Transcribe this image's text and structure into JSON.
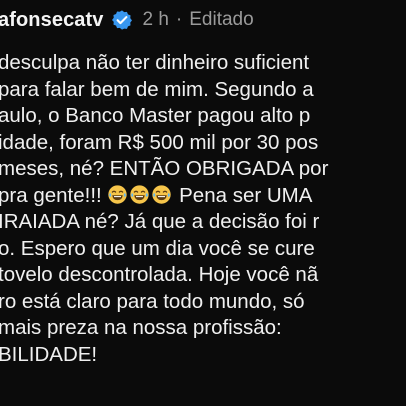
{
  "post": {
    "username": "afonsecatv",
    "time": "2 h",
    "separator": "·",
    "edited_label": "Editado",
    "verified_icon": "verified-badge-icon",
    "colors": {
      "background": "#0b0b0b",
      "text": "#f0f0f0",
      "meta": "#9a9a9a",
      "verified": "#3897f0"
    }
  },
  "comment": {
    "lines": [
      "desculpa não ter dinheiro suficient",
      "para falar bem de mim. Segundo a",
      "aulo, o Banco Master pagou alto p",
      "idade, foram R$ 500 mil por 30 pos",
      "meses, né? ENTÃO OBRIGADA por",
      "pra gente!!!",
      " Pena ser UMA",
      "IRAIADA né? Já que a decisão foi r",
      "o. Espero que um dia você se cure",
      "tovelo descontrolada. Hoje você nã",
      "ro está claro para todo mundo, só",
      "mais preza na nossa profissão:",
      "BILIDADE!"
    ],
    "emoji": [
      "😂",
      "😂",
      "😂"
    ],
    "emoji_icon": "laughing-tears-emoji-icon"
  }
}
